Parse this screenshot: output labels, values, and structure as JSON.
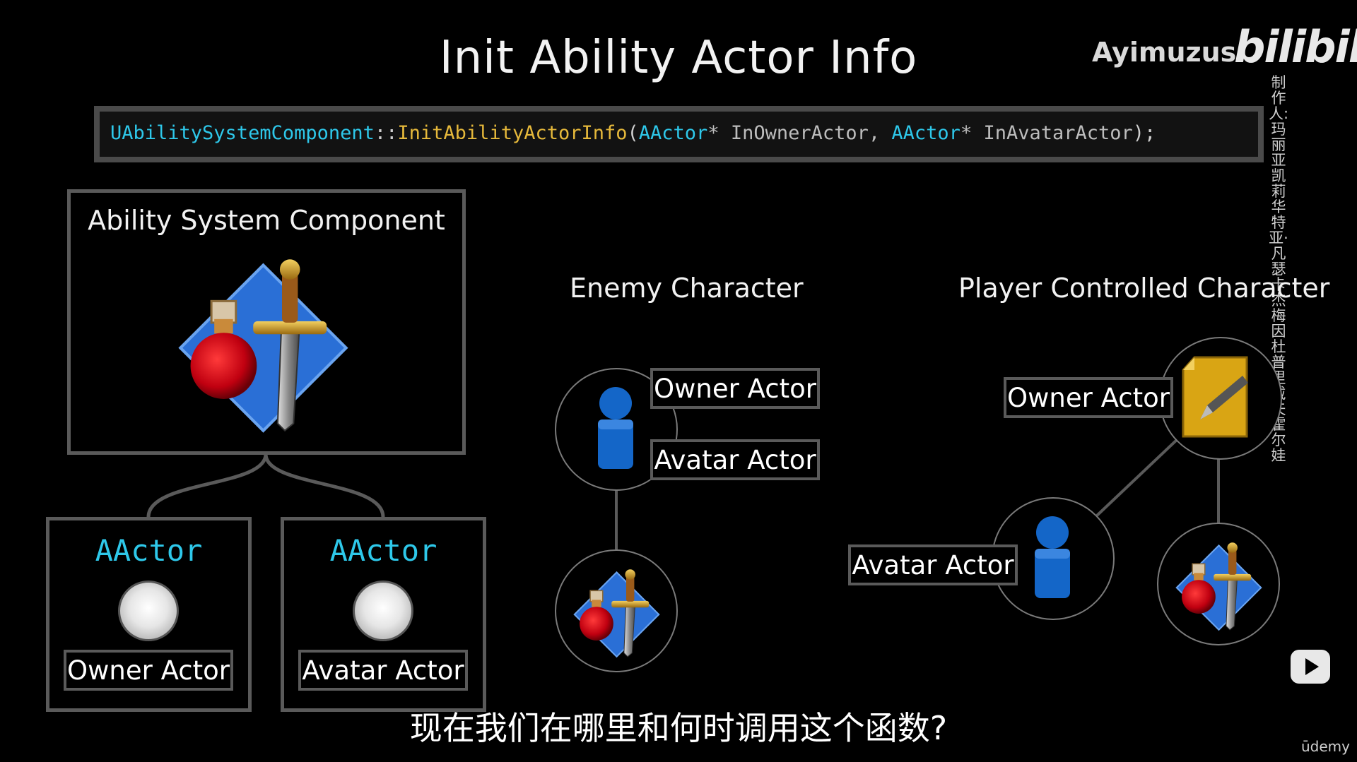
{
  "title": "Init Ability Actor Info",
  "watermark": {
    "name": "Ayimuzus",
    "logo": "bilibili",
    "credit": "制作人:玛丽亚凯莉华特亚·凡瑟卡杰梅因杜普里戴夫霍尔娃"
  },
  "code": {
    "class": "UAbilitySystemComponent",
    "scope": "::",
    "function": "InitAbilityActorInfo",
    "open": "(",
    "type1": "AActor",
    "ptr1": "* InOwnerActor, ",
    "type2": "AActor",
    "ptr2": "* InAvatarActor",
    "close": ");"
  },
  "left_diagram": {
    "asc_label": "Ability System Component",
    "left_child": {
      "type": "AActor",
      "role": "Owner Actor"
    },
    "right_child": {
      "type": "AActor",
      "role": "Avatar Actor"
    }
  },
  "enemy": {
    "heading": "Enemy Character",
    "owner_label": "Owner Actor",
    "avatar_label": "Avatar Actor"
  },
  "player": {
    "heading": "Player Controlled Character",
    "owner_label": "Owner Actor",
    "avatar_label": "Avatar Actor"
  },
  "subtitle": "现在我们在哪里和何时调用这个函数?",
  "footer": {
    "brand": "ūdemy"
  },
  "colors": {
    "code_type": "#2ec8ea",
    "code_function": "#e6b93b",
    "box_border": "#5a5a5a",
    "asc_diamond": "#2a6fd6",
    "potion": "#c8101a",
    "pawn": "#1466c8",
    "controller": "#d9a514"
  },
  "icons": [
    "ability-system-component-icon",
    "pawn-icon",
    "player-controller-icon",
    "play-icon"
  ]
}
